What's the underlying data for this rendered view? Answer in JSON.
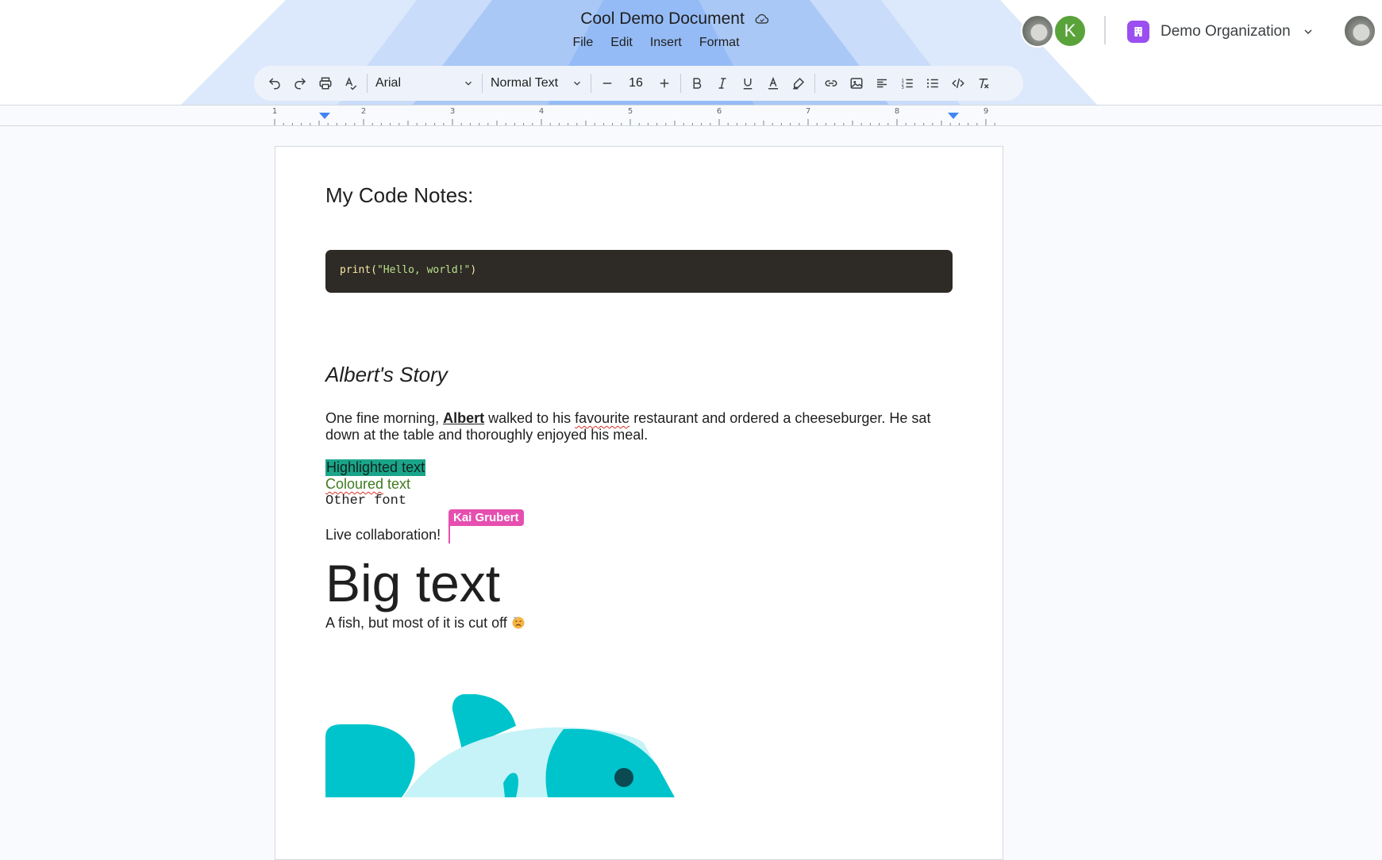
{
  "header": {
    "title": "Cool Demo Document",
    "menu": [
      "File",
      "Edit",
      "Insert",
      "Format"
    ],
    "collaborators": [
      {
        "type": "photo"
      },
      {
        "type": "initial",
        "initial": "K",
        "color": "#5aa33b"
      }
    ],
    "organization": "Demo Organization"
  },
  "toolbar": {
    "font": "Arial",
    "text_style": "Normal Text",
    "font_size": "16",
    "icons": [
      "undo-icon",
      "redo-icon",
      "print-icon",
      "spellcheck-icon",
      "decrease-size-icon",
      "increase-size-icon",
      "bold-icon",
      "italic-icon",
      "underline-icon",
      "text-color-icon",
      "highlight-icon",
      "link-icon",
      "image-icon",
      "align-icon",
      "numbered-list-icon",
      "bulleted-list-icon",
      "code-icon",
      "clear-format-icon"
    ]
  },
  "ruler": {
    "numbers": [
      "1",
      "2",
      "3",
      "4",
      "5",
      "6",
      "7",
      "8",
      "9"
    ]
  },
  "document": {
    "heading_notes": "My Code Notes:",
    "code": {
      "fn": "print(",
      "str": "\"Hello, world!\"",
      "close": ")"
    },
    "heading_story": "Albert's Story",
    "para_part1": "One fine morning, ",
    "para_bold": "Albert",
    "para_part2": " walked to his ",
    "para_spell": "favourite",
    "para_part3": " restaurant and ordered a cheeseburger. He sat down at the table and thoroughly enjoyed his meal.",
    "highlighted": "Highlighted text",
    "coloured_word": "Coloured",
    "coloured_rest": " text",
    "other_font": "Other font",
    "live": "Live collaboration!",
    "cursor_user": "Kai Grubert",
    "big": "Big text",
    "fish_caption": "A fish, but most of it is cut off"
  },
  "colors": {
    "accent": "#4285f4",
    "collab_cursor": "#e64fb0",
    "highlight": "#1aa58a",
    "coloured_text": "#3e7a1f",
    "fish_main": "#00c4cc",
    "fish_light": "#c6f3f7"
  }
}
